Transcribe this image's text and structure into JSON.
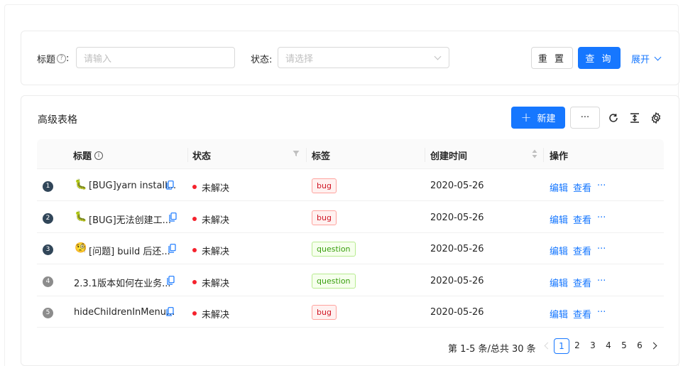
{
  "search": {
    "title_label": "标题",
    "title_help_icon": "question-circle-icon",
    "title_placeholder": "请输入",
    "status_label": "状态:",
    "status_placeholder": "请选择",
    "reset_label": "重 置",
    "query_label": "查 询",
    "expand_label": "展开"
  },
  "table": {
    "title": "高级表格",
    "new_label": "新建",
    "more_label": "···",
    "toolbar_icons": [
      "reload-icon",
      "column-height-icon",
      "setting-icon"
    ],
    "columns": {
      "title": "标题",
      "status": "状态",
      "labels": "标签",
      "created_at": "创建时间",
      "actions": "操作"
    },
    "rows": [
      {
        "index": "1",
        "emoji": "🐛",
        "title": "[BUG]yarn install...",
        "status": "未解决",
        "tag": "bug",
        "date": "2020-05-26",
        "edit": "编辑",
        "view": "查看",
        "more": "···"
      },
      {
        "index": "2",
        "emoji": "🐛",
        "title": "[BUG]无法创建工...",
        "status": "未解决",
        "tag": "bug",
        "date": "2020-05-26",
        "edit": "编辑",
        "view": "查看",
        "more": "···"
      },
      {
        "index": "3",
        "emoji": "🧐",
        "title": "[问题] build 后还...",
        "status": "未解决",
        "tag": "question",
        "date": "2020-05-26",
        "edit": "编辑",
        "view": "查看",
        "more": "···"
      },
      {
        "index": "4",
        "emoji": "",
        "title": "2.3.1版本如何在业务...",
        "status": "未解决",
        "tag": "question",
        "date": "2020-05-26",
        "edit": "编辑",
        "view": "查看",
        "more": "···"
      },
      {
        "index": "5",
        "emoji": "",
        "title": "hideChildrenInMenu...",
        "status": "未解决",
        "tag": "bug",
        "date": "2020-05-26",
        "edit": "编辑",
        "view": "查看",
        "more": "···"
      }
    ]
  },
  "pagination": {
    "total_text": "第 1-5 条/总共 30 条",
    "pages": [
      "1",
      "2",
      "3",
      "4",
      "5",
      "6"
    ],
    "current": "1"
  },
  "colors": {
    "primary": "#1677ff",
    "status_unresolved": "#f5222d",
    "bug_tag_bg": "#fff1f0",
    "bug_tag_border": "#ffa39e",
    "bug_tag_text": "#cf1322",
    "question_tag_bg": "#f6ffed",
    "question_tag_border": "#b7eb8f",
    "question_tag_text": "#389e0d"
  }
}
